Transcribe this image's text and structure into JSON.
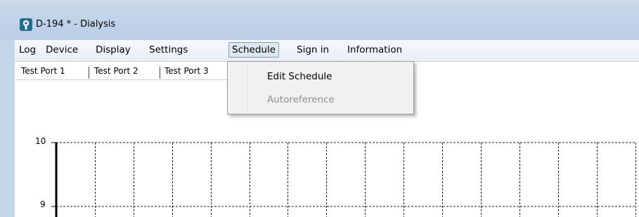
{
  "window": {
    "title": "D-194 * - Dialysis",
    "icon": "app-logo-icon"
  },
  "menubar": {
    "items": [
      "Log",
      "Device",
      "Display",
      "Settings",
      "Schedule",
      "Sign in",
      "Information"
    ],
    "open_menu": "Schedule"
  },
  "tabs": [
    "Test Port 1",
    "Test Port 2",
    "Test Port 3"
  ],
  "active_tab": "Test Port 1",
  "schedule_menu": {
    "items": [
      {
        "label": "Edit Schedule",
        "enabled": true
      },
      {
        "label": "Autoreference",
        "enabled": false
      }
    ]
  },
  "chart_data": {
    "type": "line",
    "series": [],
    "yticks": [
      "10",
      "9"
    ],
    "grid": true,
    "colors": {
      "axis": "#000000",
      "grid": "#222222"
    }
  }
}
